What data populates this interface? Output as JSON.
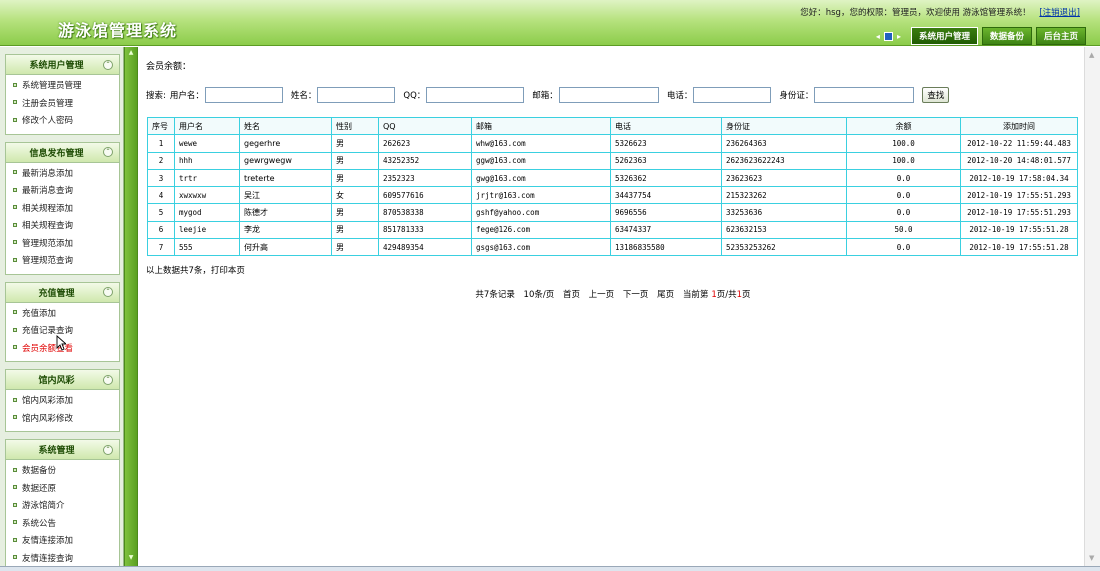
{
  "header": {
    "title": "游泳馆管理系统",
    "welcome": "您好：hsg，您的权限：管理员，欢迎使用 游泳馆管理系统！",
    "logout": "[注销退出]",
    "tabs": [
      "系统用户管理",
      "数据备份",
      "后台主页"
    ]
  },
  "sidebar": {
    "groups": [
      {
        "title": "系统用户管理",
        "items": [
          "系统管理员管理",
          "注册会员管理",
          "修改个人密码"
        ]
      },
      {
        "title": "信息发布管理",
        "items": [
          "最新消息添加",
          "最新消息查询",
          "相关规程添加",
          "相关规程查询",
          "管理规范添加",
          "管理规范查询"
        ]
      },
      {
        "title": "充值管理",
        "items": [
          "充值添加",
          "充值记录查询",
          "会员余额查看"
        ]
      },
      {
        "title": "馆内风彩",
        "items": [
          "馆内风彩添加",
          "馆内风彩修改"
        ]
      },
      {
        "title": "系统管理",
        "items": [
          "数据备份",
          "数据还原",
          "游泳馆简介",
          "系统公告",
          "友情连接添加",
          "友情连接查询"
        ]
      }
    ]
  },
  "main": {
    "balance_label": "会员余额：",
    "search": {
      "prefix": "搜索:",
      "username_label": "用户名：",
      "name_label": "姓名：",
      "qq_label": "QQ：",
      "email_label": "邮箱：",
      "phone_label": "电话：",
      "id_label": "身份证：",
      "button": "查找"
    },
    "table": {
      "headers": [
        "序号",
        "用户名",
        "姓名",
        "性别",
        "QQ",
        "邮箱",
        "电话",
        "身份证",
        "余额",
        "添加时间"
      ],
      "rows": [
        [
          "1",
          "wewe",
          "gegerhre",
          "男",
          "262623",
          "whw@163.com",
          "5326623",
          "236264363",
          "100.0",
          "2012-10-22 11:59:44.483"
        ],
        [
          "2",
          "hhh",
          "gewrgwegw",
          "男",
          "43252352",
          "ggw@163.com",
          "5262363",
          "2623623622243",
          "100.0",
          "2012-10-20 14:48:01.577"
        ],
        [
          "3",
          "trtr",
          "treterte",
          "男",
          "2352323",
          "gwg@163.com",
          "5326362",
          "23623623",
          "0.0",
          "2012-10-19 17:58:04.34"
        ],
        [
          "4",
          "xwxwxw",
          "吴江",
          "女",
          "609577616",
          "jrjtr@163.com",
          "34437754",
          "215323262",
          "0.0",
          "2012-10-19 17:55:51.293"
        ],
        [
          "5",
          "mygod",
          "陈德才",
          "男",
          "870538338",
          "gshf@yahoo.com",
          "9696556",
          "33253636",
          "0.0",
          "2012-10-19 17:55:51.293"
        ],
        [
          "6",
          "leejie",
          "李龙",
          "男",
          "851781333",
          "fege@126.com",
          "63474337",
          "623632153",
          "50.0",
          "2012-10-19 17:55:51.28"
        ],
        [
          "7",
          "555",
          "何升高",
          "男",
          "429489354",
          "gsgs@163.com",
          "13186835580",
          "52353253262",
          "0.0",
          "2012-10-19 17:55:51.28"
        ]
      ]
    },
    "summary": "以上数据共7条，打印本页",
    "pager": {
      "total": "共7条记录",
      "per_page": "10条/页",
      "first": "首页",
      "prev": "上一页",
      "next": "下一页",
      "last": "尾页",
      "current_prefix": "当前第",
      "current_page": "1",
      "current_mid": "页/共",
      "total_pages": "1",
      "current_suffix": "页"
    }
  },
  "icons": {
    "collapse": "collapse-icon",
    "nav_prev": "nav-prev-icon",
    "nav_next": "nav-next-icon",
    "cursor": "mouse-cursor-icon"
  },
  "colors": {
    "header_green": "#8ccc4a",
    "table_border": "#3ad0e0",
    "active_link": "#e00000"
  }
}
